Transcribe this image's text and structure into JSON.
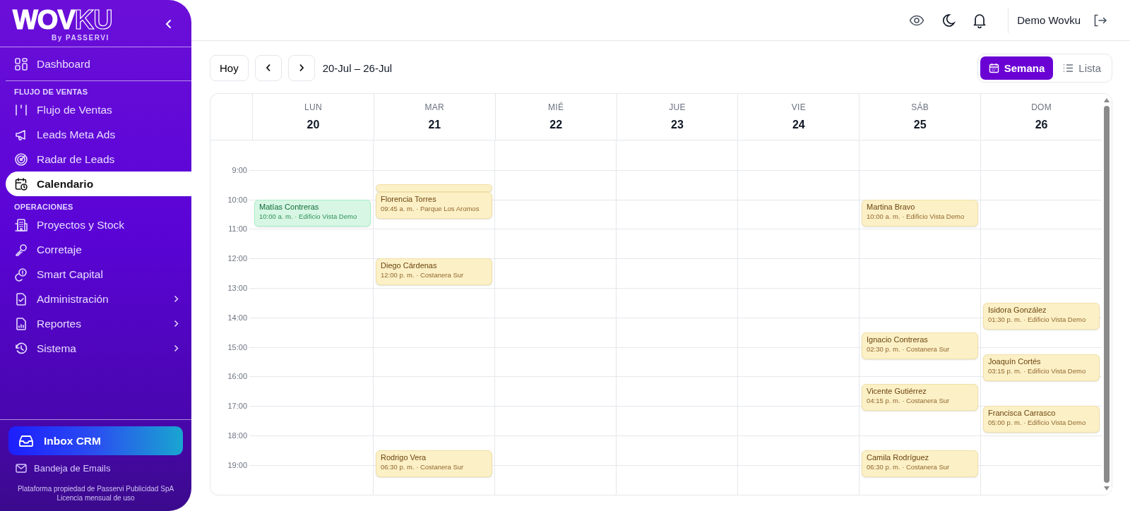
{
  "sidebar": {
    "logo": "**WOV**KU",
    "logo_subtitle": "By PASSERVI",
    "sections": [
      {
        "items": [
          {
            "label": "Dashboard",
            "selected": false,
            "has_submenu": false
          }
        ]
      },
      {
        "title": "FLUJO DE VENTAS",
        "items": [
          {
            "label": "Flujo de Ventas",
            "selected": false,
            "has_submenu": false
          },
          {
            "label": "Leads Meta Ads",
            "selected": false,
            "has_submenu": false
          },
          {
            "label": "Radar de Leads",
            "selected": false,
            "has_submenu": false
          },
          {
            "label": "Calendario",
            "selected": true,
            "has_submenu": false
          }
        ]
      },
      {
        "title": "OPERACIONES",
        "items": [
          {
            "label": "Proyectos y Stock",
            "selected": false,
            "has_submenu": false
          },
          {
            "label": "Corretaje",
            "selected": false,
            "has_submenu": false
          },
          {
            "label": "Smart Capital",
            "selected": false,
            "has_submenu": false
          },
          {
            "label": "Administración",
            "selected": false,
            "has_submenu": true
          },
          {
            "label": "Reportes",
            "selected": false,
            "has_submenu": true
          },
          {
            "label": "Sistema",
            "selected": false,
            "has_submenu": true
          }
        ]
      }
    ],
    "inbox_button": "Inbox CRM",
    "email_link": "Bandeja de Emails",
    "footer": [
      "Plataforma propiedad de Passervi Publicidad SpA",
      "Licencia mensual de uso"
    ]
  },
  "topbar": {
    "user_name": "Demo Wovku"
  },
  "toolbar": {
    "today_button": "Hoy",
    "range": "20-Jul – 26-Jul",
    "views": [
      {
        "label": "Semana",
        "selected": true
      },
      {
        "label": "Lista",
        "selected": false
      }
    ]
  },
  "calendar": {
    "hours": [
      "9:00",
      "10:00",
      "11:00",
      "12:00",
      "13:00",
      "14:00",
      "15:00",
      "16:00",
      "17:00",
      "18:00",
      "19:00"
    ],
    "days": [
      {
        "weekday": "LUN",
        "date": "20",
        "events": [
          {
            "name": "Matías Contreras",
            "detail": "10:00 a. m. · Edificio Vista Demo",
            "color": "#d7f6e4"
          }
        ]
      },
      {
        "weekday": "MAR",
        "date": "21",
        "events": [
          {
            "color": "#fcf0c6"
          },
          {
            "name": "Florencia Torres",
            "detail": "09:45 a. m. · Parque Los Aromos",
            "color": "#fcf0c6"
          },
          {
            "name": "Diego Cárdenas",
            "detail": "12:00 p. m. · Costanera Sur",
            "color": "#fcf0c6"
          },
          {
            "name": "Rodrigo Vera",
            "detail": "06:30 p. m. · Costanera Sur",
            "color": "#fcf0c6"
          }
        ]
      },
      {
        "weekday": "MIÉ",
        "date": "22"
      },
      {
        "weekday": "JUE",
        "date": "23"
      },
      {
        "weekday": "VIE",
        "date": "24"
      },
      {
        "weekday": "SÁB",
        "date": "25",
        "events": [
          {
            "name": "Martina Bravo",
            "detail": "10:00 a. m. · Edificio Vista Demo",
            "color": "#fcf0c6"
          },
          {
            "name": "Ignacio Contreras",
            "detail": "02:30 p. m. · Costanera Sur",
            "color": "#fcf0c6"
          },
          {
            "name": "Vicente Gutiérrez",
            "detail": "04:15 p. m. · Costanera Sur",
            "color": "#fcf0c6"
          },
          {
            "name": "Camila Rodríguez",
            "detail": "06:30 p. m. · Costanera Sur",
            "color": "#fcf0c6"
          }
        ]
      },
      {
        "weekday": "DOM",
        "date": "26",
        "events": [
          {
            "name": "Isidora González",
            "detail": "01:30 p. m. · Edificio Vista Demo",
            "color": "#fcf0c6"
          },
          {
            "name": "Joaquín Cortés",
            "detail": "03:15 p. m. · Edificio Vista Demo",
            "color": "#fcf0c6"
          },
          {
            "name": "Francisca Carrasco",
            "detail": "05:00 p. m. · Edificio Vista Demo",
            "color": "#fcf0c6"
          }
        ]
      }
    ]
  }
}
